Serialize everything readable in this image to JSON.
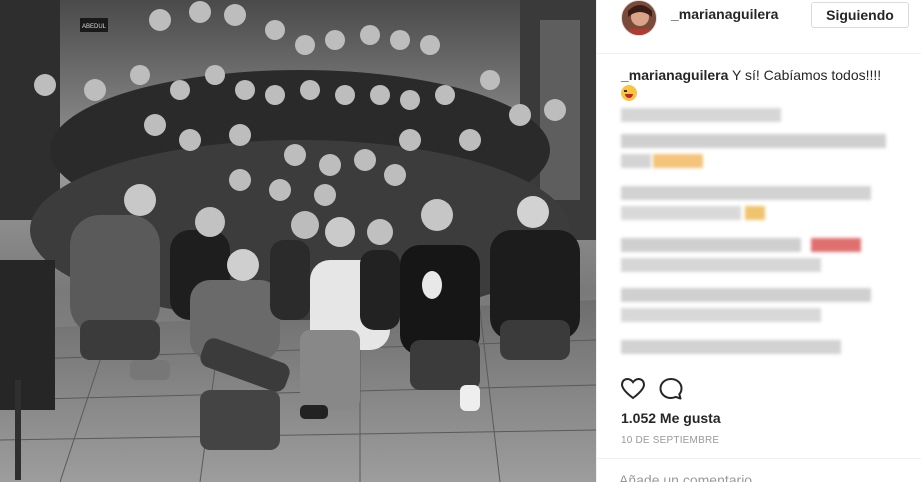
{
  "post": {
    "username": "_marianaguilera",
    "follow_button_label": "Siguiendo",
    "caption_username": "_marianaguilera",
    "caption_text": "Y sí! Cabíamos todos!!!!",
    "caption_emoji_icon": "grinning-tongue-emoji-icon",
    "likes_text": "1.052 Me gusta",
    "date_text": "10 DE SEPTIEMBRE",
    "comment_placeholder": "Añade un comentario..."
  },
  "photo": {
    "alt_subject": "group-photo",
    "sign_text": "ABEDUL"
  },
  "icons": {
    "like": "heart-icon",
    "comment": "comment-icon"
  },
  "colors": {
    "text": "#262626",
    "muted": "#999999",
    "border": "#dbdbdb",
    "blur_orange": "#f5b96b",
    "blur_red": "#e06060",
    "blur_gray": "#d8d8d8"
  }
}
